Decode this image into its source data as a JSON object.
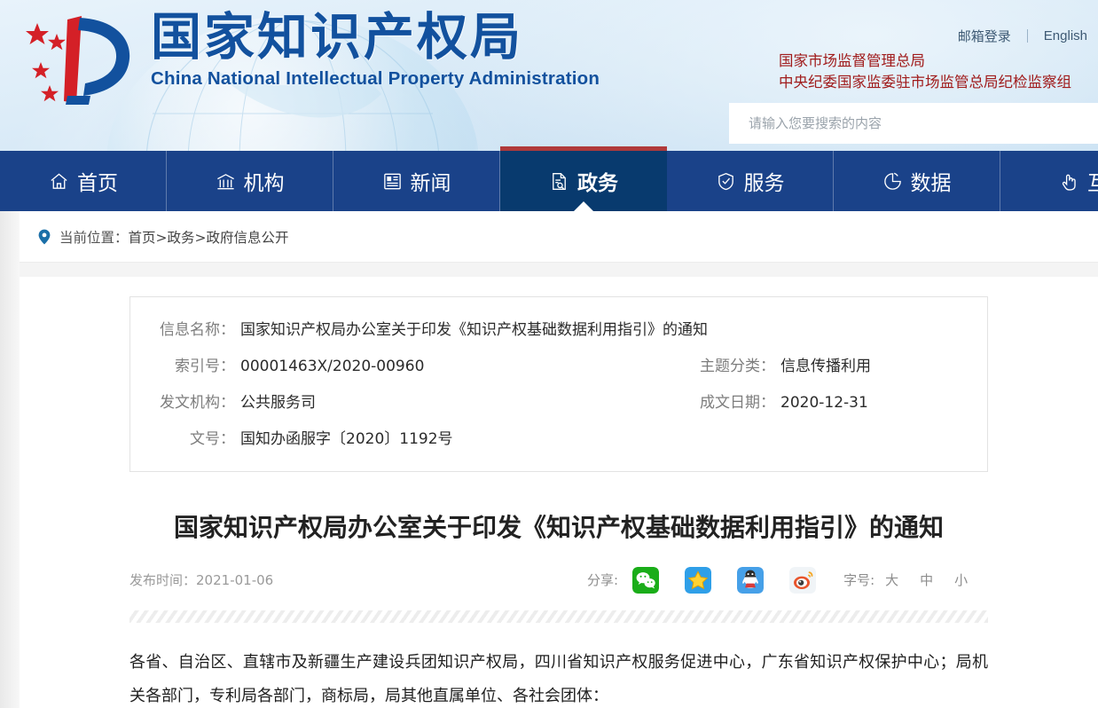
{
  "header": {
    "logo_cn": "国家知识产权局",
    "logo_en": "China National Intellectual Property Administration",
    "mail_login": "邮箱登录",
    "english": "English",
    "red_org_line1": "国家市场监督管理总局",
    "red_org_line2": "中央纪委国家监委驻市场监管总局纪检监察组",
    "search_placeholder": "请输入您要搜索的内容",
    "search_value": "",
    "colors": {
      "logo_blue": "#12519e",
      "red_org": "#a01b1b",
      "banner_bg": "#dcecf8"
    }
  },
  "nav": {
    "active_index": 3,
    "colors": {
      "bar": "#1a4289",
      "active": "#083a6e",
      "active_top": "#b03a3a"
    },
    "items": [
      {
        "label": "首页",
        "icon": "home-icon"
      },
      {
        "label": "机构",
        "icon": "bank-icon"
      },
      {
        "label": "新闻",
        "icon": "newspaper-icon"
      },
      {
        "label": "政务",
        "icon": "document-search-icon"
      },
      {
        "label": "服务",
        "icon": "shield-check-icon"
      },
      {
        "label": "数据",
        "icon": "pie-chart-icon"
      },
      {
        "label": "互",
        "icon": "hand-pointer-icon"
      }
    ]
  },
  "breadcrumb": {
    "icon": "location-pin-icon",
    "prefix": "当前位置：",
    "path": "首页>政务>政府信息公开"
  },
  "meta": {
    "rows": [
      {
        "label": "信息名称：",
        "value": "国家知识产权局办公室关于印发《知识产权基础数据利用指引》的通知"
      },
      {
        "label": "索引号：",
        "value": "00001463X/2020-00960",
        "label2": "主题分类：",
        "value2": "信息传播利用"
      },
      {
        "label": "发文机构：",
        "value": "公共服务司",
        "label2": "成文日期：",
        "value2": "2020-12-31"
      },
      {
        "label": "文号：",
        "value": "国知办函服字〔2020〕1192号"
      }
    ]
  },
  "article": {
    "title": "国家知识产权局办公室关于印发《知识产权基础数据利用指引》的通知",
    "publish_label": "发布时间：",
    "publish_date": "2021-01-06",
    "share_label": "分享:",
    "share_icons": [
      {
        "name": "wechat-share-icon",
        "color": "#1aad19"
      },
      {
        "name": "qzone-share-icon",
        "color": "#2f9fe8"
      },
      {
        "name": "qq-share-icon",
        "color": "#46a0e8"
      },
      {
        "name": "weibo-share-icon",
        "color": "#e6a23c"
      }
    ],
    "fontsize_label": "字号:",
    "fontsize_options": [
      "大",
      "中",
      "小"
    ],
    "body_paragraph": "各省、自治区、直辖市及新疆生产建设兵团知识产权局，四川省知识产权服务促进中心，广东省知识产权保护中心；局机关各部门，专利局各部门，商标局，局其他直属单位、各社会团体："
  }
}
